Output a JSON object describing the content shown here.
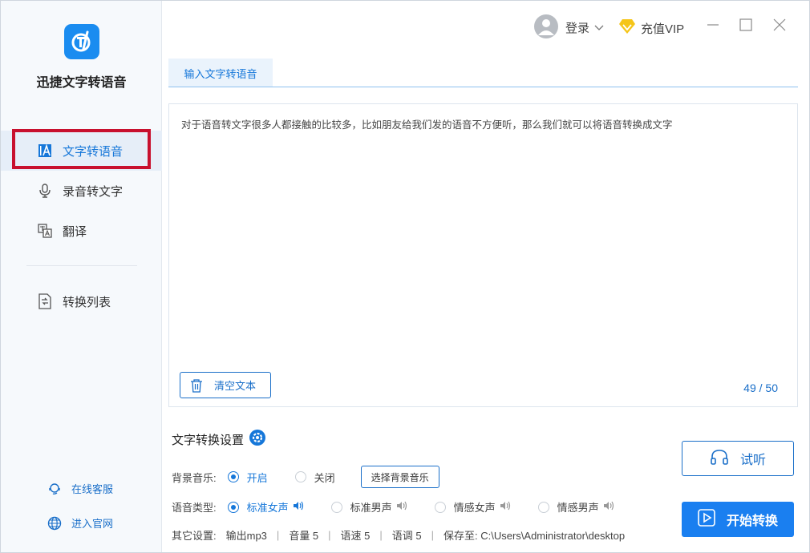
{
  "app": {
    "name": "迅捷文字转语音",
    "accent": "#1677d9"
  },
  "sidebar": {
    "items": [
      {
        "label": "文字转语音",
        "icon": "text-a-icon",
        "active": true
      },
      {
        "label": "录音转文字",
        "icon": "microphone-icon",
        "active": false
      },
      {
        "label": "翻译",
        "icon": "translate-icon",
        "active": false
      },
      {
        "label": "转换列表",
        "icon": "list-convert-icon",
        "active": false
      }
    ],
    "links": [
      {
        "label": "在线客服",
        "icon": "customer-service-icon"
      },
      {
        "label": "进入官网",
        "icon": "globe-icon"
      }
    ]
  },
  "titlebar": {
    "login_label": "登录",
    "vip_label": "充值VIP"
  },
  "tabs": [
    {
      "label": "输入文字转语音",
      "active": true
    }
  ],
  "editor": {
    "text": "对于语音转文字很多人都接触的比较多，比如朋友给我们发的语音不方便听，那么我们就可以将语音转换成文字",
    "clear_label": "清空文本",
    "counter": "49 / 50"
  },
  "settings": {
    "title": "文字转换设置",
    "bg_music": {
      "label": "背景音乐:",
      "options": [
        {
          "label": "开启",
          "checked": true
        },
        {
          "label": "关闭",
          "checked": false
        }
      ],
      "select_label": "选择背景音乐"
    },
    "voice": {
      "label": "语音类型:",
      "options": [
        {
          "label": "标准女声",
          "checked": true
        },
        {
          "label": "标准男声",
          "checked": false
        },
        {
          "label": "情感女声",
          "checked": false
        },
        {
          "label": "情感男声",
          "checked": false
        }
      ]
    },
    "other": {
      "label": "其它设置:",
      "items": [
        "输出mp3",
        "音量 5",
        "语速 5",
        "语调 5",
        "保存至: C:\\Users\\Administrator\\desktop"
      ]
    }
  },
  "actions": {
    "listen_label": "试听",
    "start_label": "开始转换"
  }
}
